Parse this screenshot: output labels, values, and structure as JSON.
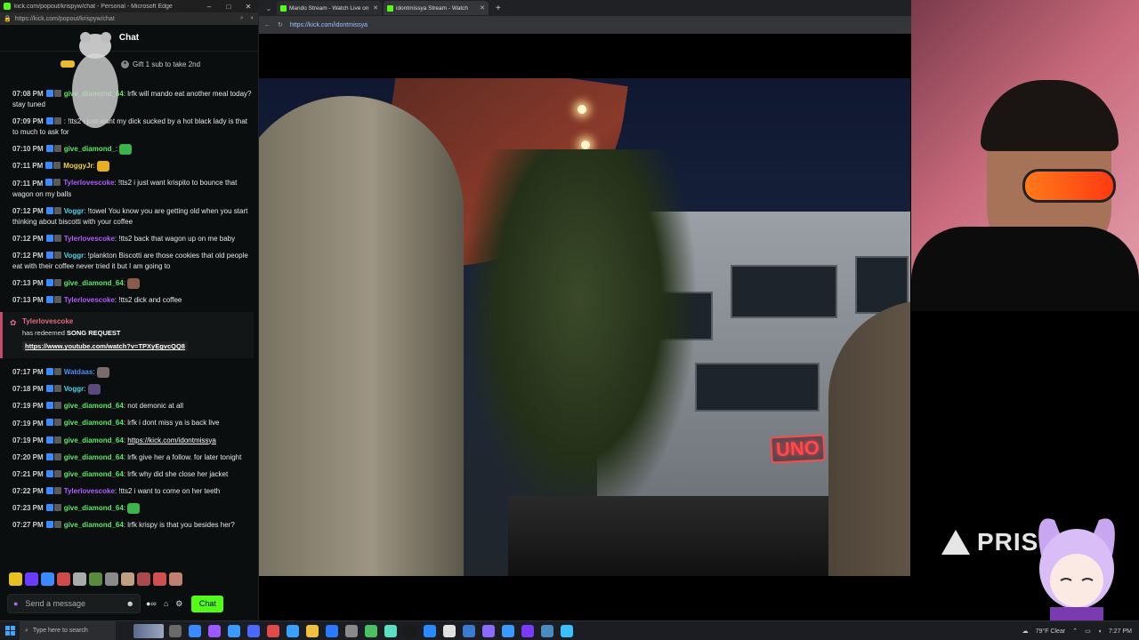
{
  "chat_window": {
    "title": "kick.com/popout/krispyw/chat - Personal - Microsoft Edge",
    "url": "https://kick.com/popout/krispyw/chat",
    "controls": [
      "–",
      "□",
      "✕"
    ],
    "header": "Chat",
    "gift_text": "Gift 1 sub to take 2nd",
    "messages": [
      {
        "time": "07:08 PM",
        "user": "give_diamond_64",
        "user_color": "#5ee86a",
        "text": "lrfk will mando eat another meal today? stay tuned",
        "emote": ""
      },
      {
        "time": "07:09 PM",
        "user": "",
        "user_color": "#5ee86a",
        "text": "!tts2 i just want my dick sucked by a hot black lady is that to much to ask for",
        "emote": ""
      },
      {
        "time": "07:10 PM",
        "user": "give_diamond_",
        "user_color": "#5ee86a",
        "text": "",
        "emote": "#3cb44b"
      },
      {
        "time": "07:11 PM",
        "user": "MoggyJr",
        "user_color": "#f2d33c",
        "text": "",
        "emote": "#e8b020"
      },
      {
        "time": "07:11 PM",
        "user": "Tylerlovescoke",
        "user_color": "#b05cff",
        "text": "!tts2 i just want krispito to bounce that wagon on my balls",
        "emote": ""
      },
      {
        "time": "07:12 PM",
        "user": "Voggr",
        "user_color": "#4fd1e8",
        "text": "!towel You know you are getting old when you start thinking about biscotti with your coffee",
        "emote": ""
      },
      {
        "time": "07:12 PM",
        "user": "Tylerlovescoke",
        "user_color": "#b05cff",
        "text": "!tts2 back that wagon up on me baby",
        "emote": ""
      },
      {
        "time": "07:12 PM",
        "user": "Voggr",
        "user_color": "#4fd1e8",
        "text": "!plankton Biscotti are those cookies that old people eat with their coffee never tried it but I am going to",
        "emote": ""
      },
      {
        "time": "07:13 PM",
        "user": "give_diamond_64",
        "user_color": "#5ee86a",
        "text": "",
        "emote": "#8a5a4a"
      },
      {
        "time": "07:13 PM",
        "user": "Tylerlovescoke",
        "user_color": "#b05cff",
        "text": "!tts2 dick and coffee",
        "emote": ""
      }
    ],
    "redeem": {
      "user": "Tylerlovescoke",
      "prefix": "has redeemed",
      "reward": "SONG REQUEST",
      "link": "https://www.youtube.com/watch?v=TPXyEgvcQQ8"
    },
    "messages2": [
      {
        "time": "07:17 PM",
        "user": "Watdaas",
        "user_color": "#4a8cff",
        "text": "",
        "emote": "#7a6a6a",
        "link": ""
      },
      {
        "time": "07:18 PM",
        "user": "Voggr",
        "user_color": "#4fd1e8",
        "text": "",
        "emote": "#5a4a7a",
        "link": ""
      },
      {
        "time": "07:19 PM",
        "user": "give_diamond_64",
        "user_color": "#5ee86a",
        "text": "not demonic at all",
        "emote": "",
        "link": ""
      },
      {
        "time": "07:19 PM",
        "user": "give_diamond_64",
        "user_color": "#5ee86a",
        "text": "lrfk i dont miss ya is back live",
        "emote": "",
        "link": ""
      },
      {
        "time": "07:19 PM",
        "user": "give_diamond_64",
        "user_color": "#5ee86a",
        "text": "",
        "emote": "",
        "link": "https://kick.com/idontmissya"
      },
      {
        "time": "07:20 PM",
        "user": "give_diamond_64",
        "user_color": "#5ee86a",
        "text": "lrfk give her a follow. for later tonight",
        "emote": "",
        "link": ""
      },
      {
        "time": "07:21 PM",
        "user": "give_diamond_64",
        "user_color": "#5ee86a",
        "text": "lrfk why did she close her jacket",
        "emote": "",
        "link": ""
      },
      {
        "time": "07:22 PM",
        "user": "Tylerlovescoke",
        "user_color": "#b05cff",
        "text": "!tts2 i want to come on her teeth",
        "emote": "",
        "link": ""
      },
      {
        "time": "07:23 PM",
        "user": "give_diamond_64",
        "user_color": "#5ee86a",
        "text": "",
        "emote": "#3cb44b",
        "link": ""
      },
      {
        "time": "07:27 PM",
        "user": "give_diamond_64",
        "user_color": "#5ee86a",
        "text": "lrfk krispy is that you besides her?",
        "emote": "",
        "link": ""
      }
    ],
    "emote_bar": [
      "#e8c020",
      "#6a3cff",
      "#3c8aff",
      "#d04a4a",
      "#aaaaaa",
      "#5a8a3a",
      "#8a8a8a",
      "#c0a080",
      "#aa4a4a",
      "#d05050",
      "#c08070"
    ],
    "input_placeholder": "Send a message",
    "send_label": "Chat"
  },
  "browser": {
    "tabs": [
      {
        "label": "Mando Stream - Watch Live on Ki",
        "active": false
      },
      {
        "label": "idontmissya Stream - Watch",
        "active": true
      }
    ],
    "url": "https://kick.com/idontmissya",
    "video_signs": {
      "uno": "UNO",
      "neon": "O"
    },
    "watermark": "PRIS"
  },
  "taskbar": {
    "search_placeholder": "Type here to search",
    "apps": [
      "#6a6a6a",
      "#3c8aff",
      "#9a5aff",
      "#3a9aff",
      "#4a6aff",
      "#e04a4a",
      "#3aa0ff",
      "#f0c040",
      "#2a7aff",
      "#8a8a8a",
      "#4ac060",
      "#5ae0c0",
      "#1a1a1a",
      "#2a8aff",
      "#e0e0e0",
      "#3a7ad0",
      "#8a6aff",
      "#3a9aff",
      "#7a3aff",
      "#4a8ac0",
      "#3ac0ff"
    ],
    "weather": "79°F Clear",
    "time": "7:27 PM"
  }
}
